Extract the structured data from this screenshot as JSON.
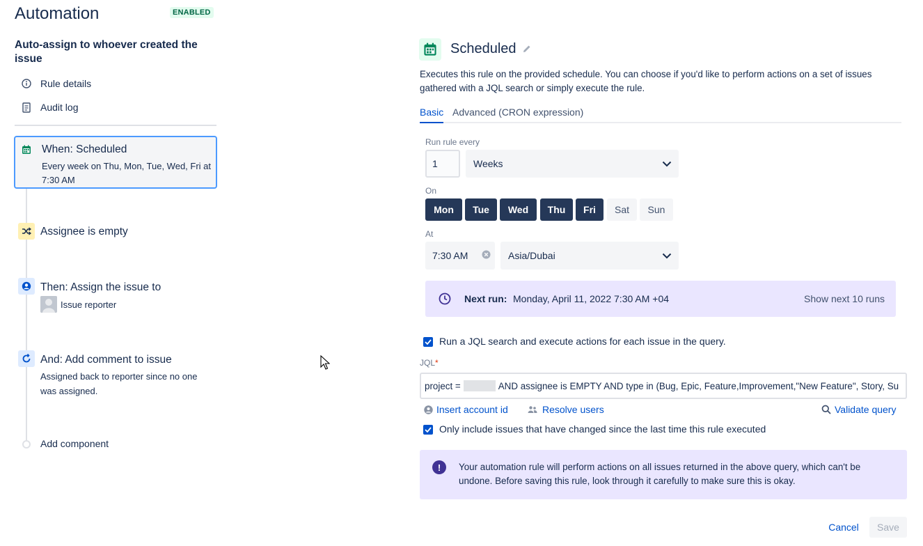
{
  "header": {
    "title": "Automation",
    "status_badge": "ENABLED"
  },
  "rule": {
    "name": "Auto-assign to whoever created the issue"
  },
  "nav": {
    "rule_details": "Rule details",
    "audit_log": "Audit log"
  },
  "components": {
    "trigger": {
      "title": "When: Scheduled",
      "desc": "Every week on Thu, Mon, Tue, Wed, Fri at 7:30 AM"
    },
    "condition": {
      "title": "Assignee is empty"
    },
    "action1": {
      "title": "Then: Assign the issue to",
      "desc": "Issue reporter"
    },
    "action2": {
      "title": "And: Add comment to issue",
      "desc": "Assigned back to reporter since no one was assigned."
    },
    "add_component": "Add component"
  },
  "editor": {
    "title": "Scheduled",
    "description": "Executes this rule on the provided schedule. You can choose if you'd like to perform actions on a set of issues gathered with a JQL search or simply execute the rule.",
    "tabs": [
      "Basic",
      "Advanced (CRON expression)"
    ],
    "run_every_label": "Run rule every",
    "run_every_value": "1",
    "interval_unit": "Weeks",
    "on_label": "On",
    "days": [
      {
        "label": "Mon",
        "selected": true
      },
      {
        "label": "Tue",
        "selected": true
      },
      {
        "label": "Wed",
        "selected": true
      },
      {
        "label": "Thu",
        "selected": true
      },
      {
        "label": "Fri",
        "selected": true
      },
      {
        "label": "Sat",
        "selected": false
      },
      {
        "label": "Sun",
        "selected": false
      }
    ],
    "at_label": "At",
    "time_value": "7:30 AM",
    "timezone": "Asia/Dubai",
    "next_run_label": "Next run:",
    "next_run_value": "Monday, April 11, 2022 7:30 AM +04",
    "show_next_runs": "Show next 10 runs",
    "jql_checkbox": {
      "label": "Run a JQL search and execute actions for each issue in the query.",
      "checked": true
    },
    "jql_label": "JQL",
    "jql_required_mark": "*",
    "jql_prefix": "project =",
    "jql_suffix": "AND assignee is EMPTY AND type in (Bug, Epic, Feature,Improvement,\"New Feature\", Story, Su",
    "insert_account_id": "Insert account id",
    "resolve_users": "Resolve users",
    "validate_query": "Validate query",
    "changed_checkbox": {
      "label": "Only include issues that have changed since the last time this rule executed",
      "checked": true
    },
    "warning_text": "Your automation rule will perform actions on all issues returned in the above query, which can't be undone. Before saving this rule, look through it carefully to make sure this is okay.",
    "cancel": "Cancel",
    "save": "Save"
  },
  "colors": {
    "accent": "#0052cc",
    "day_selected_bg": "#253858",
    "info_panel_bg": "#eae6ff",
    "badge_bg": "#e3fcef",
    "badge_text": "#006644"
  }
}
